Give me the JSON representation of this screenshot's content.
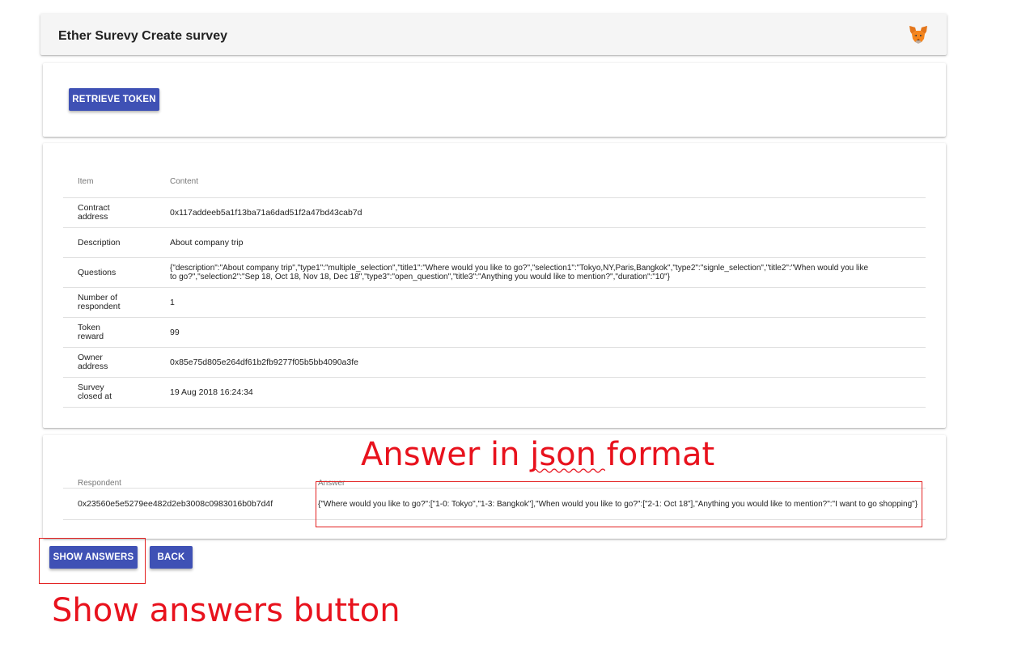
{
  "app": {
    "title": "Ether Surevy Create survey",
    "account_icon": "metamask-fox-icon"
  },
  "token_section": {
    "retrieve_label": "RETRIEVE TOKEN"
  },
  "details": {
    "headers": [
      "Item",
      "Content"
    ],
    "rows": [
      {
        "item": "Contract address",
        "content": "0x117addeeb5a1f13ba71a6dad51f2a47bd43cab7d"
      },
      {
        "item": "Description",
        "content": "About company trip"
      },
      {
        "item": "Questions",
        "content": "{\"description\":\"About company trip\",\"type1\":\"multiple_selection\",\"title1\":\"Where would you like to go?\",\"selection1\":\"Tokyo,NY,Paris,Bangkok\",\"type2\":\"signle_selection\",\"title2\":\"When would you like to go?\",\"selection2\":\"Sep 18, Oct 18, Nov 18, Dec 18\",\"type3\":\"open_question\",\"title3\":\"Anything you would like to mention?\",\"duration\":\"10\"}"
      },
      {
        "item": "Number of respondent",
        "content": "1"
      },
      {
        "item": "Token reward",
        "content": "99"
      },
      {
        "item": "Owner address",
        "content": "0x85e75d805e264df61b2fb9277f05b5bb4090a3fe"
      },
      {
        "item": "Survey closed at",
        "content": "19 Aug 2018 16:24:34"
      }
    ]
  },
  "answers": {
    "headers": [
      "Respondent",
      "Answer"
    ],
    "rows": [
      {
        "respondent": "0x23560e5e5279ee482d2eb3008c0983016b0b7d4f",
        "answer": "{\"Where would you like to go?\":[\"1-0: Tokyo\",\"1-3: Bangkok\"],\"When would you like to go?\":[\"2-1: Oct 18\"],\"Anything you would like to mention?\":\"I want to go shopping\"}"
      }
    ]
  },
  "actions": {
    "show_answers_label": "SHOW ANSWERS",
    "back_label": "BACK"
  },
  "annotations": {
    "answer_json": "Answer in json format",
    "show_answers": "Show answers button",
    "color": "#e8121d"
  },
  "colors": {
    "primary_button": "#3f51b5",
    "appbar_bg": "#f5f5f5"
  }
}
